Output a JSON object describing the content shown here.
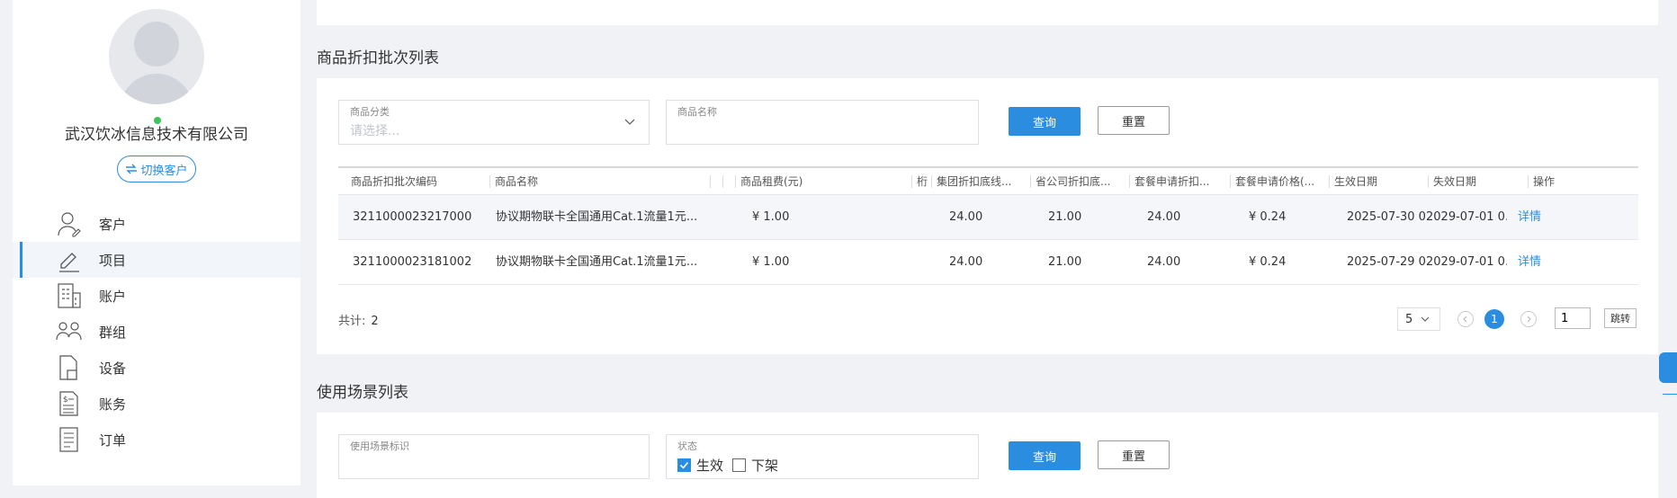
{
  "sidebar": {
    "company_name": "武汉饮冰信息技术有限公司",
    "switch_label": "切换客户",
    "nav": [
      {
        "label": "客户",
        "icon": "user-icon",
        "active": false
      },
      {
        "label": "项目",
        "icon": "pencil-icon",
        "active": true
      },
      {
        "label": "账户",
        "icon": "account-icon",
        "active": false
      },
      {
        "label": "群组",
        "icon": "group-icon",
        "active": false
      },
      {
        "label": "设备",
        "icon": "device-icon",
        "active": false
      },
      {
        "label": "账务",
        "icon": "bill-icon",
        "active": false
      },
      {
        "label": "订单",
        "icon": "order-icon",
        "active": false
      }
    ]
  },
  "goods": {
    "title": "商品折扣批次列表",
    "filter_category_label": "商品分类",
    "filter_category_placeholder": "请选择...",
    "filter_name_label": "商品名称",
    "query_label": "查询",
    "reset_label": "重置",
    "columns": [
      "商品折扣批次编码",
      "商品名称",
      "商品租费(元)",
      "桁",
      "集团折扣底线...",
      "省公司折扣底...",
      "套餐申请折扣...",
      "套餐申请价格(...",
      "生效日期",
      "失效日期",
      "操作"
    ],
    "rows": [
      {
        "code": "3211000023217000",
        "name": "协议期物联卡全国通用Cat.1流量1元...",
        "rent": "¥ 1.00",
        "group": "24.00",
        "prov": "21.00",
        "apply": "24.00",
        "price": "¥ 0.24",
        "start": "2025-07-30 0...",
        "end": "2029-07-01 0...",
        "op": "详情"
      },
      {
        "code": "3211000023181002",
        "name": "协议期物联卡全国通用Cat.1流量1元...",
        "rent": "¥ 1.00",
        "group": "24.00",
        "prov": "21.00",
        "apply": "24.00",
        "price": "¥ 0.24",
        "start": "2025-07-29 0...",
        "end": "2029-07-01 0...",
        "op": "详情"
      }
    ],
    "total_label": "共计:",
    "total_count": "2",
    "page_size": "5",
    "current_page": "1",
    "jump_value": "1",
    "jump_label": "跳转"
  },
  "scene": {
    "title": "使用场景列表",
    "filter_id_label": "使用场景标识",
    "filter_status_label": "状态",
    "status_options": [
      {
        "label": "生效",
        "checked": true
      },
      {
        "label": "下架",
        "checked": false
      }
    ],
    "query_label": "查询",
    "reset_label": "重置"
  },
  "colors": {
    "primary": "#2a8de0",
    "online": "#3cc35a"
  }
}
